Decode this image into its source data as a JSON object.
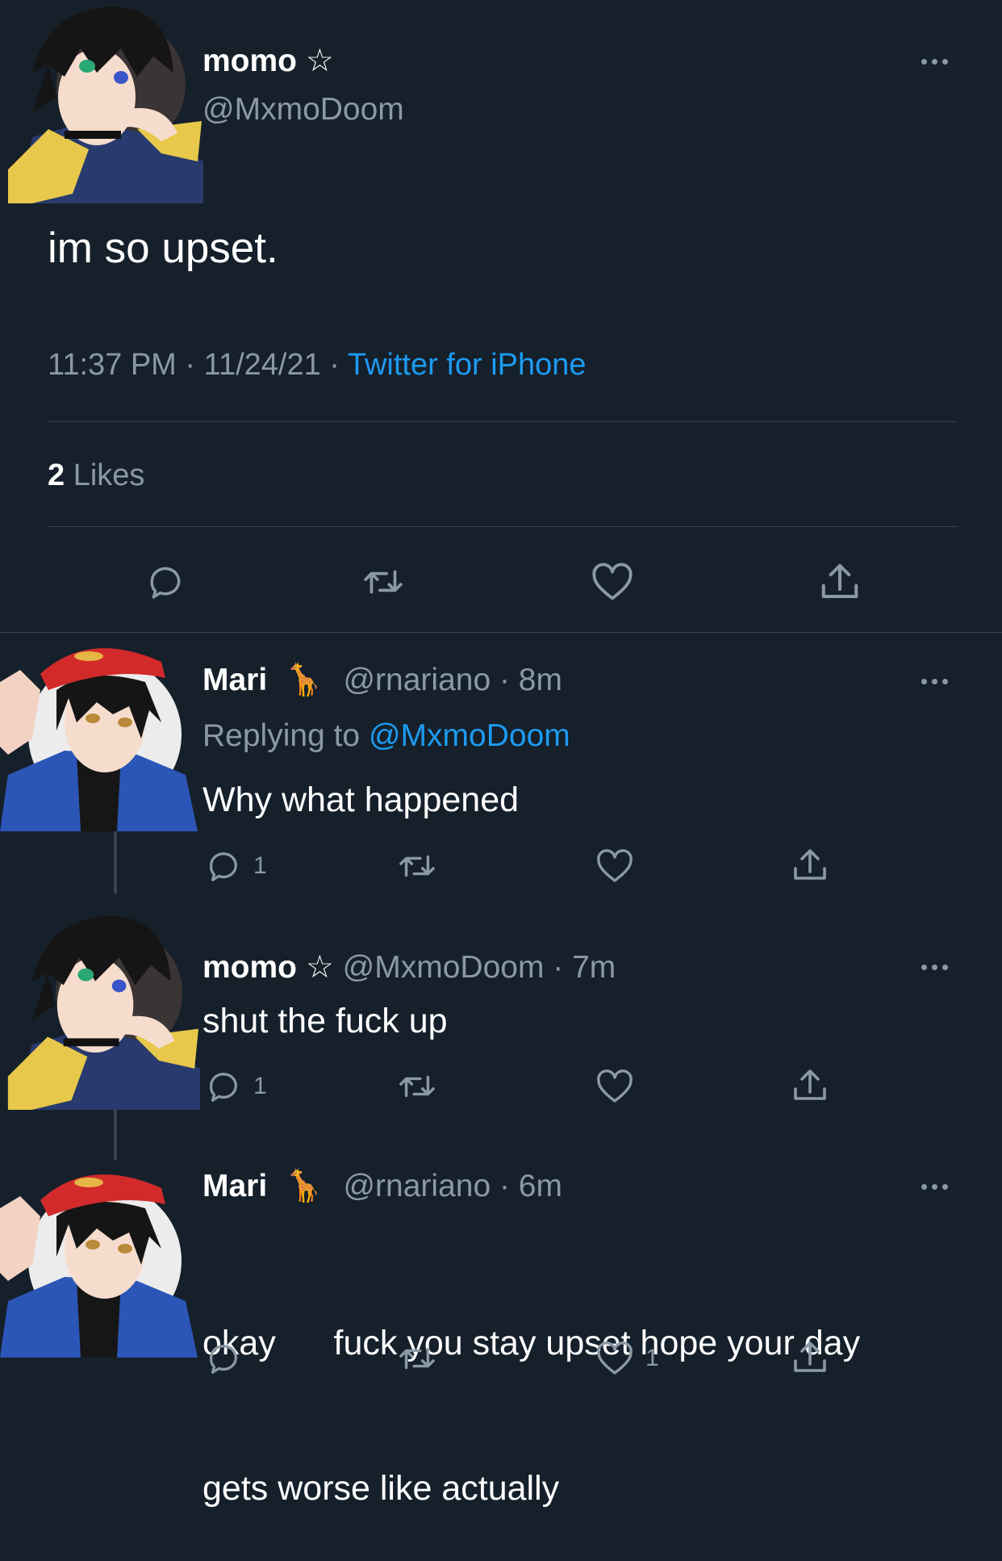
{
  "main_tweet": {
    "name": "momo ☆",
    "handle": "@MxmoDoom",
    "text": "im so upset.",
    "time": "11:37 PM",
    "sep1": "·",
    "date": "11/24/21",
    "sep2": "·",
    "source": "Twitter for iPhone",
    "likes_count": "2",
    "likes_label": "Likes"
  },
  "replies": [
    {
      "name": "Mari",
      "emoji": "🦒",
      "handle": "@rnariano",
      "time": "· 8m",
      "replying_prefix": "Replying to",
      "replying_handle": "@MxmoDoom",
      "text": "Why what happened",
      "reply_count": "1",
      "like_count": ""
    },
    {
      "name": "momo ☆",
      "handle": "@MxmoDoom",
      "time": "· 7m",
      "text": "shut the fuck up",
      "reply_count": "1",
      "like_count": ""
    },
    {
      "name": "Mari",
      "emoji": "🦒",
      "handle": "@rnariano",
      "time": "· 6m",
      "text_line1": "okay      fuck you stay upset hope your day",
      "text_line2": "gets worse like actually",
      "reply_count": "",
      "like_count": "1"
    }
  ],
  "icons": [
    "reply-icon",
    "retweet-icon",
    "like-icon",
    "share-icon",
    "more-icon"
  ],
  "colors": {
    "background": "#15202b",
    "accent": "#1d9bf0",
    "muted": "#8b98a5",
    "divider": "#38444d"
  }
}
